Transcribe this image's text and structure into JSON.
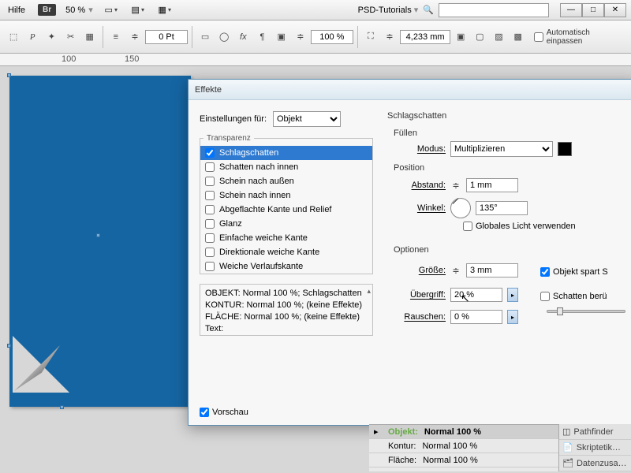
{
  "menubar": {
    "help": "Hilfe",
    "br": "Br",
    "zoom": "50 %",
    "tutorials": "PSD-Tutorials"
  },
  "toolbar": {
    "stroke_pt": "0 Pt",
    "opacity": "100 %",
    "width": "4,233 mm",
    "auto_fit": "Automatisch einpassen"
  },
  "ruler": {
    "m100": "100",
    "m150": "150"
  },
  "dialog": {
    "title": "Effekte",
    "settings_for": "Einstellungen für:",
    "settings_target": "Objekt",
    "transparency_label": "Transparenz",
    "items": [
      {
        "label": "Schlagschatten",
        "checked": true,
        "selected": true
      },
      {
        "label": "Schatten nach innen",
        "checked": false
      },
      {
        "label": "Schein nach außen",
        "checked": false
      },
      {
        "label": "Schein nach innen",
        "checked": false
      },
      {
        "label": "Abgeflachte Kante und Relief",
        "checked": false
      },
      {
        "label": "Glanz",
        "checked": false
      },
      {
        "label": "Einfache weiche Kante",
        "checked": false
      },
      {
        "label": "Direktionale weiche Kante",
        "checked": false
      },
      {
        "label": "Weiche Verlaufskante",
        "checked": false
      }
    ],
    "summary": {
      "l1": "OBJEKT: Normal 100 %; Schlagschatten",
      "l2": "KONTUR: Normal 100 %; (keine Effekte)",
      "l3": "FLÄCHE: Normal 100 %; (keine Effekte)",
      "l4": "Text:"
    },
    "preview": "Vorschau",
    "right": {
      "heading": "Schlagschatten",
      "fill": "Füllen",
      "mode": "Modus:",
      "mode_value": "Multiplizieren",
      "position": "Position",
      "distance": "Abstand:",
      "distance_val": "1 mm",
      "angle": "Winkel:",
      "angle_val": "135°",
      "global_light": "Globales Licht verwenden",
      "options": "Optionen",
      "size": "Größe:",
      "size_val": "3 mm",
      "spread": "Übergriff:",
      "spread_val": "20 %",
      "noise": "Rauschen:",
      "noise_val": "0 %",
      "obj_saves": "Objekt spart S",
      "shadow_touch": "Schatten berü"
    }
  },
  "panels": {
    "object": "Objekt:",
    "object_val": "Normal 100 %",
    "contour": "Kontur:",
    "contour_val": "Normal 100 %",
    "area": "Fläche:",
    "area_val": "Normal 100 %",
    "side1": "Skriptetik…",
    "side2": "Datenzusa…",
    "side0": "Pathfinder"
  }
}
